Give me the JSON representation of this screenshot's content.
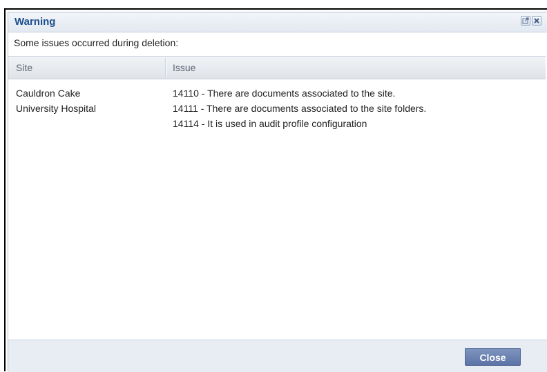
{
  "dialog": {
    "title": "Warning",
    "icons": [
      "external-window-icon",
      "close-icon"
    ]
  },
  "message": "Some issues occurred during deletion:",
  "table": {
    "columns": [
      "Site",
      "Issue"
    ],
    "rows": [
      {
        "site": "Cauldron Cake University Hospital",
        "site_lines": [
          "Cauldron Cake",
          "University Hospital"
        ],
        "issues": [
          "14110 - There are documents associated to the site.",
          "14111 - There are documents associated to the site folders.",
          "14114 - It is used in audit profile configuration"
        ]
      }
    ]
  },
  "footer": {
    "close_label": "Close"
  },
  "colors": {
    "title": "#1c4f8c",
    "button_bg": "#6d84b3",
    "header_text": "#5b6673"
  }
}
